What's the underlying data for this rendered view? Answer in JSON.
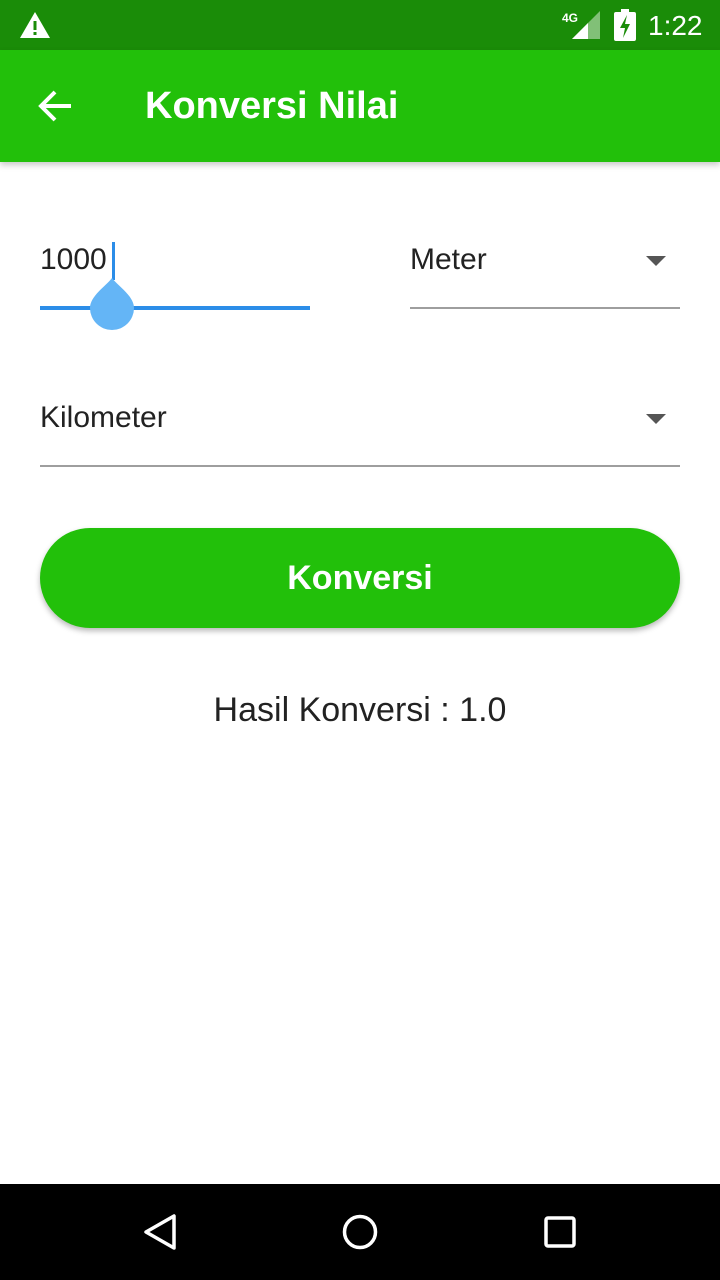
{
  "status_bar": {
    "network": "4G",
    "time": "1:22",
    "icons": [
      "warning-icon",
      "signal-icon",
      "battery-charging-icon"
    ]
  },
  "app_bar": {
    "title": "Konversi Nilai",
    "back_icon": "arrow-back-icon"
  },
  "form": {
    "input_value": "1000",
    "from_unit": "Meter",
    "to_unit": "Kilometer",
    "convert_label": "Konversi"
  },
  "result": {
    "text": "Hasil Konversi : 1.0"
  },
  "nav_bar": {
    "icons": [
      "nav-back-icon",
      "home-icon",
      "recents-icon"
    ]
  },
  "colors": {
    "status_bar": "#1a8c08",
    "primary": "#22c00a",
    "accent": "#2b8de8",
    "cursor_handle": "#64b5f6",
    "text": "#222222"
  }
}
